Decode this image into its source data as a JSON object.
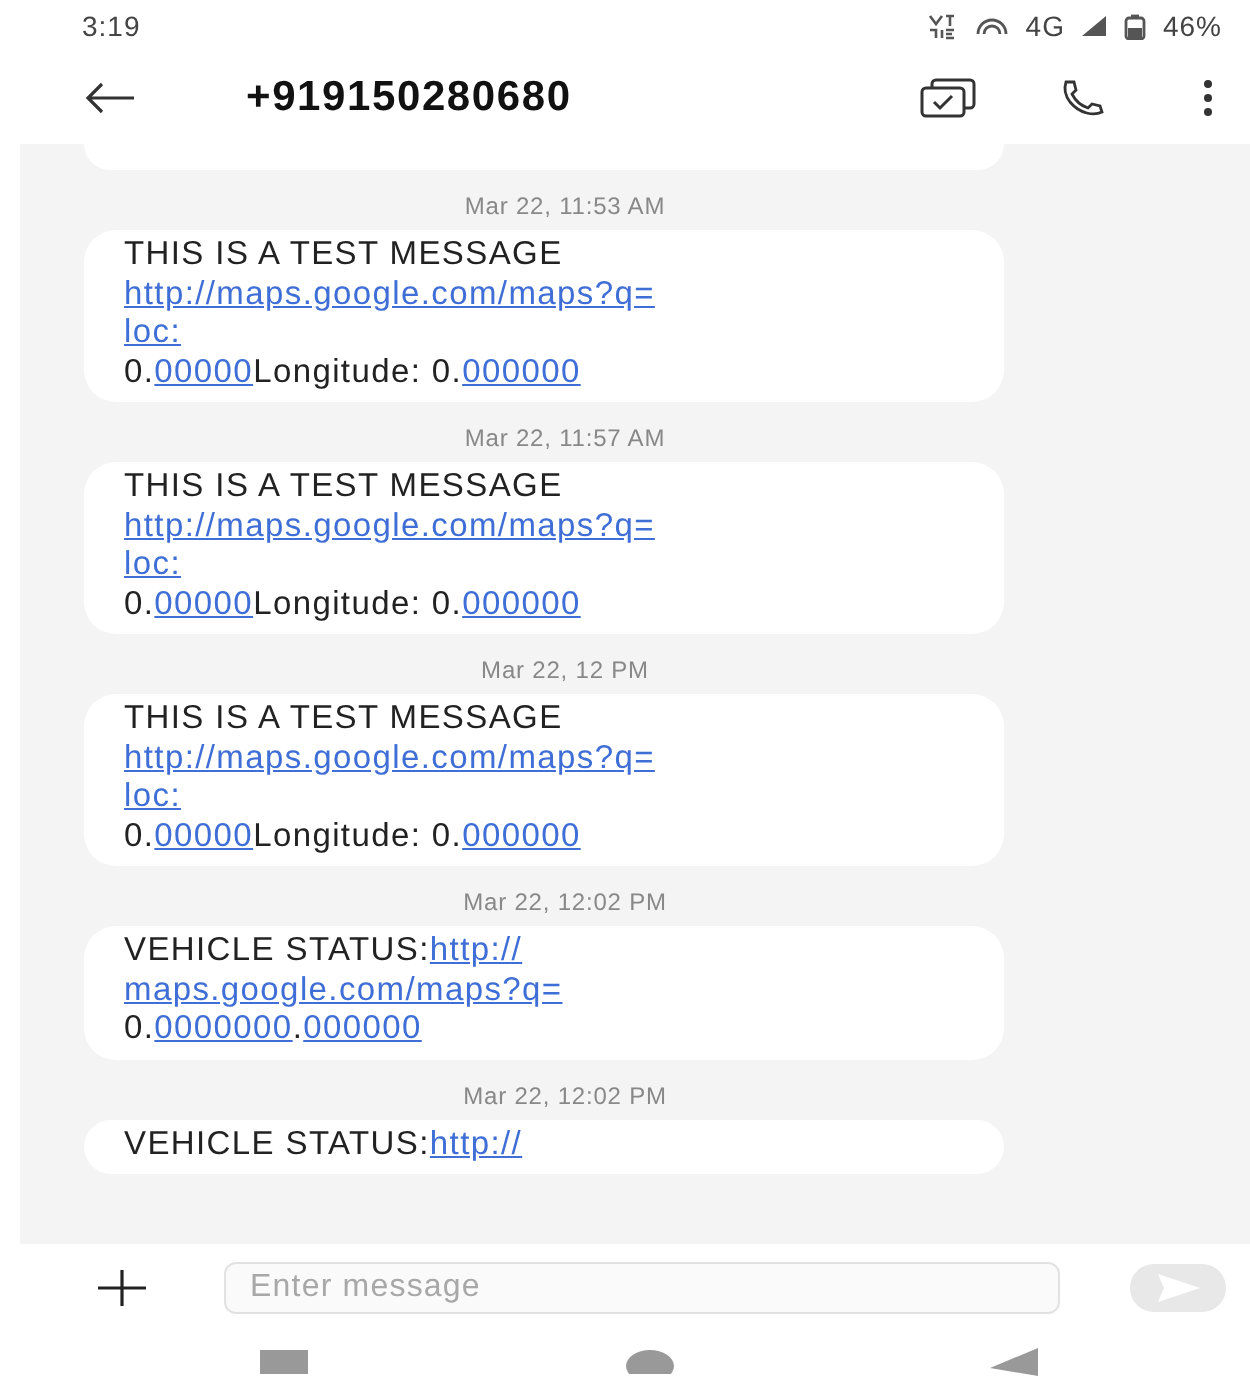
{
  "status_bar": {
    "time": "3:19",
    "network": "4G",
    "battery": "46%"
  },
  "header": {
    "title": "+919150280680"
  },
  "messages": [
    {
      "timestamp": "Mar 22, 11:53 AM",
      "lines": [
        [
          {
            "text": "THIS IS A TEST MESSAGE",
            "link": false
          }
        ],
        [
          {
            "text": "http://maps.google.com/maps?q=",
            "link": true
          }
        ],
        [
          {
            "text": "loc:",
            "link": true
          }
        ],
        [
          {
            "text": "0.",
            "link": false
          },
          {
            "text": "00000",
            "link": true
          },
          {
            "text": "Longitude: 0.",
            "link": false
          },
          {
            "text": "000000",
            "link": true
          }
        ]
      ]
    },
    {
      "timestamp": "Mar 22, 11:57 AM",
      "lines": [
        [
          {
            "text": "THIS IS A TEST MESSAGE",
            "link": false
          }
        ],
        [
          {
            "text": "http://maps.google.com/maps?q=",
            "link": true
          }
        ],
        [
          {
            "text": "loc:",
            "link": true
          }
        ],
        [
          {
            "text": "0.",
            "link": false
          },
          {
            "text": "00000",
            "link": true
          },
          {
            "text": "Longitude: 0.",
            "link": false
          },
          {
            "text": "000000",
            "link": true
          }
        ]
      ]
    },
    {
      "timestamp": "Mar 22, 12 PM",
      "lines": [
        [
          {
            "text": "THIS IS A TEST MESSAGE",
            "link": false
          }
        ],
        [
          {
            "text": "http://maps.google.com/maps?q=",
            "link": true
          }
        ],
        [
          {
            "text": "loc:",
            "link": true
          }
        ],
        [
          {
            "text": "0.",
            "link": false
          },
          {
            "text": "00000",
            "link": true
          },
          {
            "text": "Longitude: 0.",
            "link": false
          },
          {
            "text": "000000",
            "link": true
          }
        ]
      ]
    },
    {
      "timestamp": "Mar 22, 12:02 PM",
      "lines": [
        [
          {
            "text": "VEHICLE STATUS:",
            "link": false
          },
          {
            "text": "http://",
            "link": true
          }
        ],
        [
          {
            "text": "maps.google.com/maps?q=",
            "link": true
          }
        ],
        [
          {
            "text": "0.",
            "link": false
          },
          {
            "text": "0000000",
            "link": true
          },
          {
            "text": ".",
            "link": false
          },
          {
            "text": "000000",
            "link": true
          }
        ]
      ]
    },
    {
      "timestamp": "Mar 22, 12:02 PM",
      "lines": [
        [
          {
            "text": "VEHICLE STATUS:",
            "link": false
          },
          {
            "text": "http://",
            "link": true
          }
        ]
      ]
    }
  ],
  "composer": {
    "placeholder": "Enter message"
  }
}
